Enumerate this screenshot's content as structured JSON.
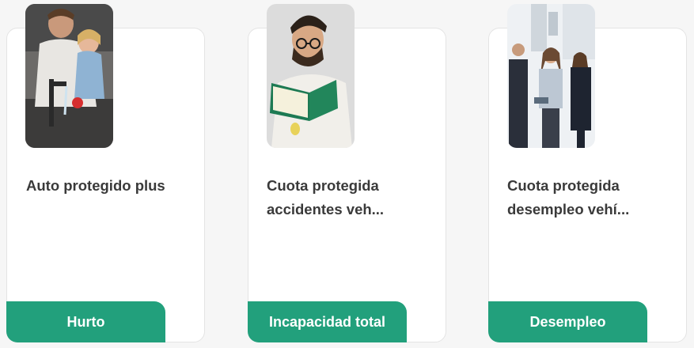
{
  "cards": [
    {
      "title": "Auto protegido plus",
      "tag": "Hurto",
      "image": "father-daughter-kitchen-photo"
    },
    {
      "title": "Cuota protegida accidentes veh...",
      "tag": "Incapacidad total",
      "image": "man-reading-book-photo"
    },
    {
      "title": "Cuota protegida desempleo vehí...",
      "tag": "Desempleo",
      "image": "business-team-photo"
    }
  ],
  "colors": {
    "accent": "#22a07c",
    "text": "#3a3a3a",
    "card_bg": "#ffffff",
    "page_bg": "#f6f6f6"
  }
}
